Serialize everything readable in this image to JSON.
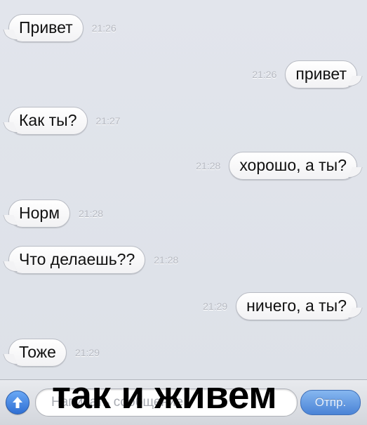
{
  "messages": [
    {
      "text": "Привет",
      "time": "21:26",
      "direction": "incoming"
    },
    {
      "text": "привет",
      "time": "21:26",
      "direction": "outgoing"
    },
    {
      "text": "Как ты?",
      "time": "21:27",
      "direction": "incoming"
    },
    {
      "text": "хорошо, а ты?",
      "time": "21:28",
      "direction": "outgoing"
    },
    {
      "text": "Норм",
      "time": "21:28",
      "direction": "incoming"
    },
    {
      "text": "Что делаешь??",
      "time": "21:28",
      "direction": "incoming"
    },
    {
      "text": "ничего, а ты?",
      "time": "21:29",
      "direction": "outgoing"
    },
    {
      "text": "Тоже",
      "time": "21:29",
      "direction": "incoming"
    }
  ],
  "input_bar": {
    "upload_icon": "arrow-up-icon",
    "placeholder": "Написать сообщение",
    "send_label": "Отпр."
  },
  "caption": "так и живем",
  "colors": {
    "accent": "#2f6fd3",
    "send": "#4a83d6",
    "time": "#b7bac2"
  }
}
